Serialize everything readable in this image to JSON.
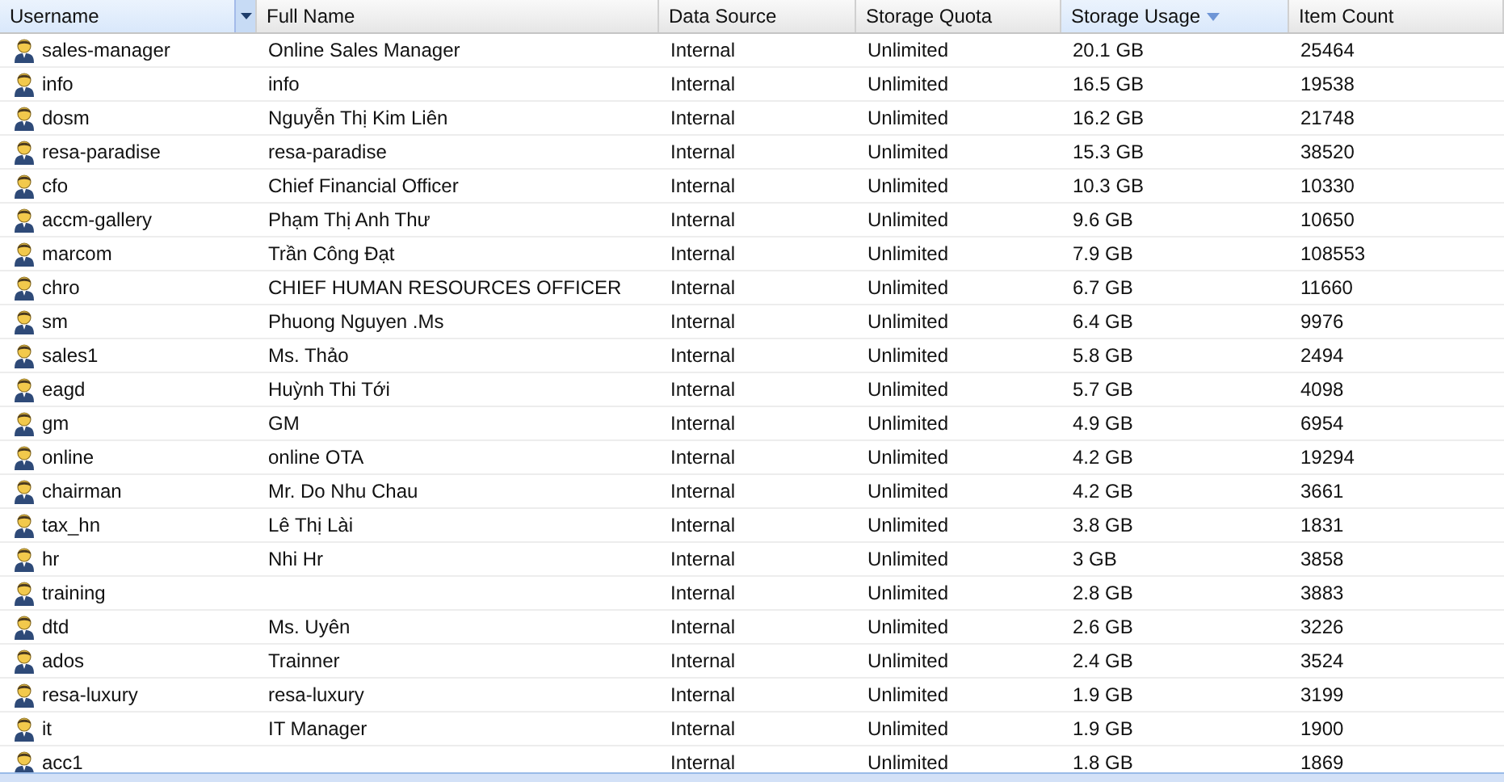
{
  "table": {
    "columns": [
      {
        "label": "Username",
        "active": true,
        "sorted": false
      },
      {
        "label": "Full Name",
        "active": false,
        "sorted": false
      },
      {
        "label": "Data Source",
        "active": false,
        "sorted": false
      },
      {
        "label": "Storage Quota",
        "active": false,
        "sorted": false
      },
      {
        "label": "Storage Usage",
        "active": false,
        "sorted": true
      },
      {
        "label": "Item Count",
        "active": false,
        "sorted": false
      }
    ],
    "rows": [
      {
        "username": "sales-manager",
        "full_name": "Online Sales Manager",
        "data_source": "Internal",
        "quota": "Unlimited",
        "usage": "20.1 GB",
        "item_count": "25464"
      },
      {
        "username": "info",
        "full_name": "info",
        "data_source": "Internal",
        "quota": "Unlimited",
        "usage": "16.5 GB",
        "item_count": "19538"
      },
      {
        "username": "dosm",
        "full_name": "Nguyễn Thị Kim Liên",
        "data_source": "Internal",
        "quota": "Unlimited",
        "usage": "16.2 GB",
        "item_count": "21748"
      },
      {
        "username": "resa-paradise",
        "full_name": "resa-paradise",
        "data_source": "Internal",
        "quota": "Unlimited",
        "usage": "15.3 GB",
        "item_count": "38520"
      },
      {
        "username": "cfo",
        "full_name": "Chief Financial Officer",
        "data_source": "Internal",
        "quota": "Unlimited",
        "usage": "10.3 GB",
        "item_count": "10330"
      },
      {
        "username": "accm-gallery",
        "full_name": "Phạm Thị Anh Thư",
        "data_source": "Internal",
        "quota": "Unlimited",
        "usage": "9.6 GB",
        "item_count": "10650"
      },
      {
        "username": "marcom",
        "full_name": "Trần Công Đạt",
        "data_source": "Internal",
        "quota": "Unlimited",
        "usage": "7.9 GB",
        "item_count": "108553"
      },
      {
        "username": "chro",
        "full_name": "CHIEF HUMAN RESOURCES OFFICER",
        "data_source": "Internal",
        "quota": "Unlimited",
        "usage": "6.7 GB",
        "item_count": "11660"
      },
      {
        "username": "sm",
        "full_name": "Phuong Nguyen .Ms",
        "data_source": "Internal",
        "quota": "Unlimited",
        "usage": "6.4 GB",
        "item_count": "9976"
      },
      {
        "username": "sales1",
        "full_name": "Ms. Thảo",
        "data_source": "Internal",
        "quota": "Unlimited",
        "usage": "5.8 GB",
        "item_count": "2494"
      },
      {
        "username": "eagd",
        "full_name": "Huỳnh Thi Tới",
        "data_source": "Internal",
        "quota": "Unlimited",
        "usage": "5.7 GB",
        "item_count": "4098"
      },
      {
        "username": "gm",
        "full_name": "GM",
        "data_source": "Internal",
        "quota": "Unlimited",
        "usage": "4.9 GB",
        "item_count": "6954"
      },
      {
        "username": "online",
        "full_name": "online OTA",
        "data_source": "Internal",
        "quota": "Unlimited",
        "usage": "4.2 GB",
        "item_count": "19294"
      },
      {
        "username": "chairman",
        "full_name": "Mr. Do Nhu Chau",
        "data_source": "Internal",
        "quota": "Unlimited",
        "usage": "4.2 GB",
        "item_count": "3661"
      },
      {
        "username": "tax_hn",
        "full_name": "Lê Thị Lài",
        "data_source": "Internal",
        "quota": "Unlimited",
        "usage": "3.8 GB",
        "item_count": "1831"
      },
      {
        "username": "hr",
        "full_name": "Nhi Hr",
        "data_source": "Internal",
        "quota": "Unlimited",
        "usage": "3 GB",
        "item_count": "3858"
      },
      {
        "username": "training",
        "data_source": "Internal",
        "quota": "Unlimited",
        "usage": "2.8 GB",
        "item_count": "3883"
      },
      {
        "username": "dtd",
        "full_name": "Ms. Uyên",
        "data_source": "Internal",
        "quota": "Unlimited",
        "usage": "2.6 GB",
        "item_count": "3226"
      },
      {
        "username": "ados",
        "full_name": "Trainner",
        "data_source": "Internal",
        "quota": "Unlimited",
        "usage": "2.4 GB",
        "item_count": "3524"
      },
      {
        "username": "resa-luxury",
        "full_name": "resa-luxury",
        "data_source": "Internal",
        "quota": "Unlimited",
        "usage": "1.9 GB",
        "item_count": "3199"
      },
      {
        "username": "it",
        "full_name": "IT Manager",
        "data_source": "Internal",
        "quota": "Unlimited",
        "usage": "1.9 GB",
        "item_count": "1900"
      },
      {
        "username": "acc1",
        "data_source": "Internal",
        "quota": "Unlimited",
        "usage": "1.8 GB",
        "item_count": "1869"
      }
    ]
  }
}
